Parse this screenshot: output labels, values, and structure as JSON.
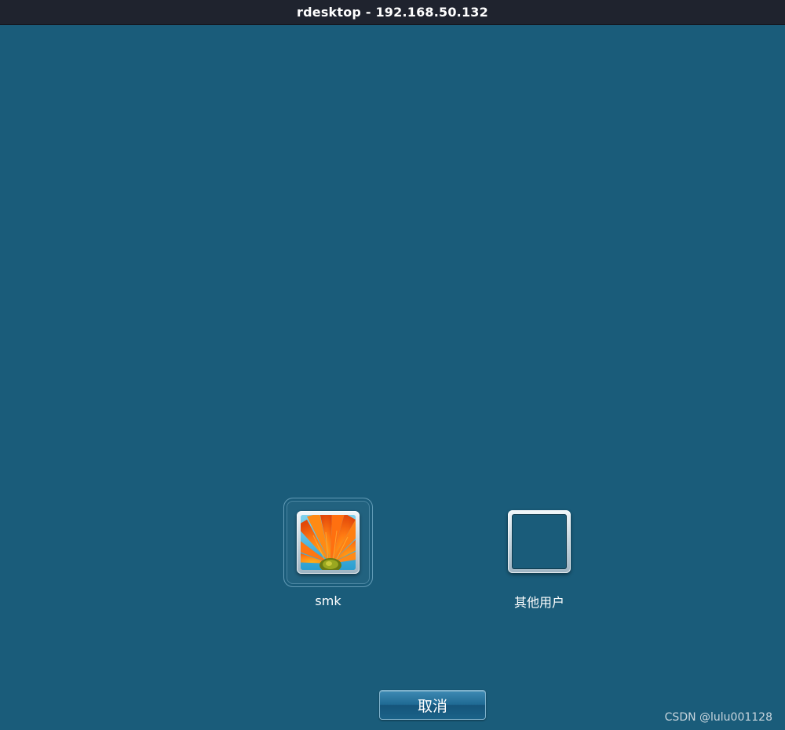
{
  "window": {
    "title": "rdesktop - 192.168.50.132"
  },
  "users": [
    {
      "label": "smk",
      "avatar": "orange-flower-icon",
      "selected": true
    },
    {
      "label": "其他用户",
      "avatar": "blank-user-icon",
      "selected": false
    }
  ],
  "actions": {
    "cancel_label": "取消"
  },
  "watermark": "CSDN @lulu001128",
  "colors": {
    "background": "#1a5c7a",
    "titlebar": "#1f232e",
    "button": "#1f6a94"
  }
}
